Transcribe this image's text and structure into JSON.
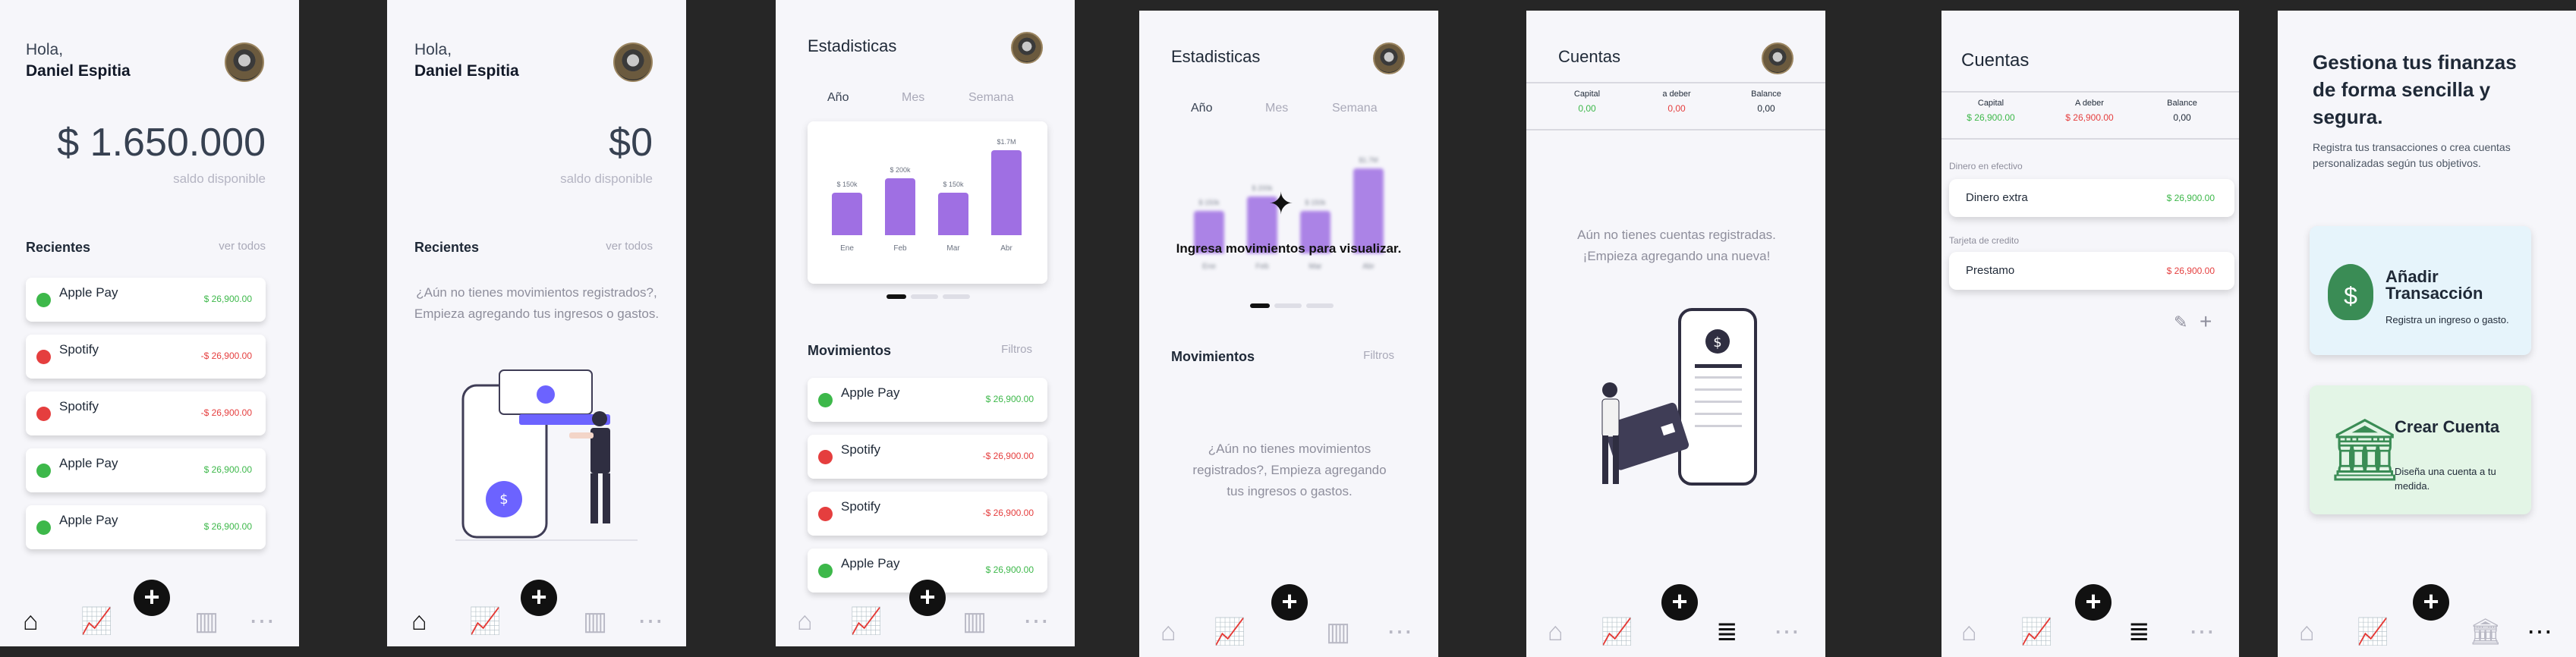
{
  "colors": {
    "accent": "#9f6fe3",
    "income": "#3db84a",
    "expense": "#e53e3e",
    "fab": "#111111"
  },
  "common": {
    "greeting": "Hola,",
    "user_name": "Daniel Espitia",
    "balance_sub": "saldo disponible",
    "recent_title": "Recientes",
    "see_all": "ver todos",
    "fab_label": "+",
    "nav_icons": [
      "house-dollar-icon",
      "chart-line-icon",
      "book-open-icon",
      "more-dots-icon"
    ],
    "nav_icons_accounts": [
      "house-dollar-icon",
      "chart-line-icon",
      "coins-stack-icon",
      "more-dots-icon"
    ]
  },
  "screen1": {
    "balance": "$ 1.650.000",
    "transactions": [
      {
        "name": "Apple Pay",
        "amount": "$ 26,900.00",
        "type": "income"
      },
      {
        "name": "Spotify",
        "amount": "-$ 26,900.00",
        "type": "expense"
      },
      {
        "name": "Spotify",
        "amount": "-$ 26,900.00",
        "type": "expense"
      },
      {
        "name": "Apple Pay",
        "amount": "$ 26,900.00",
        "type": "income"
      },
      {
        "name": "Apple Pay",
        "amount": "$ 26,900.00",
        "type": "income"
      }
    ]
  },
  "screen2": {
    "balance": "$0",
    "empty_text": "¿Aún no tienes movimientos registrados?, Empieza agregando tus ingresos o gastos."
  },
  "screen3": {
    "title": "Estadisticas",
    "tabs": [
      "Año",
      "Mes",
      "Semana"
    ],
    "movements_title": "Movimientos",
    "filters": "Filtros",
    "transactions": [
      {
        "name": "Apple Pay",
        "amount": "$ 26,900.00",
        "type": "income"
      },
      {
        "name": "Spotify",
        "amount": "-$ 26,900.00",
        "type": "expense"
      },
      {
        "name": "Spotify",
        "amount": "-$ 26,900.00",
        "type": "expense"
      },
      {
        "name": "Apple Pay",
        "amount": "$ 26,900.00",
        "type": "income"
      }
    ]
  },
  "chart_data": {
    "type": "bar",
    "categories": [
      "Ene",
      "Feb",
      "Mar",
      "Abr"
    ],
    "values": [
      150,
      200,
      150,
      300
    ],
    "value_labels": [
      "$ 150k",
      "$ 200k",
      "$ 150k",
      "$1.7M"
    ],
    "ylim": [
      0,
      300
    ]
  },
  "screen4": {
    "title": "Estadisticas",
    "tabs": [
      "Año",
      "Mes",
      "Semana"
    ],
    "overlay_text": "Ingresa movimientos para visualizar.",
    "movements_title": "Movimientos",
    "filters": "Filtros",
    "empty_text": "¿Aún no tienes movimientos registrados?, Empieza agregando tus ingresos o gastos."
  },
  "screen5": {
    "title": "Cuentas",
    "summary": [
      {
        "label": "Capital",
        "value": "0,00"
      },
      {
        "label": "a deber",
        "value": "0,00"
      },
      {
        "label": "Balance",
        "value": "0,00"
      }
    ],
    "empty_text": "Aún no tienes cuentas registradas. ¡Empieza agregando una nueva!"
  },
  "screen6": {
    "title": "Cuentas",
    "summary": [
      {
        "label": "Capital",
        "value": "$ 26,900.00"
      },
      {
        "label": "A deber",
        "value": "$ 26,900.00"
      },
      {
        "label": "Balance",
        "value": "0,00"
      }
    ],
    "group1": "Dinero en efectivo",
    "account1": {
      "name": "Dinero extra",
      "amount": "$ 26,900.00"
    },
    "group2": "Tarjeta de credito",
    "account2": {
      "name": "Prestamo",
      "amount": "$ 26,900.00"
    }
  },
  "screen7": {
    "title": "Gestiona tus finanzas de forma sencilla y segura.",
    "subtitle": "Registra tus transacciones o crea cuentas personalizadas según tus objetivos.",
    "card1": {
      "title": "Añadir Transacción",
      "desc": "Registra un ingreso o gasto."
    },
    "card2": {
      "title": "Crear Cuenta",
      "desc": "Diseña una cuenta a tu medida."
    }
  }
}
